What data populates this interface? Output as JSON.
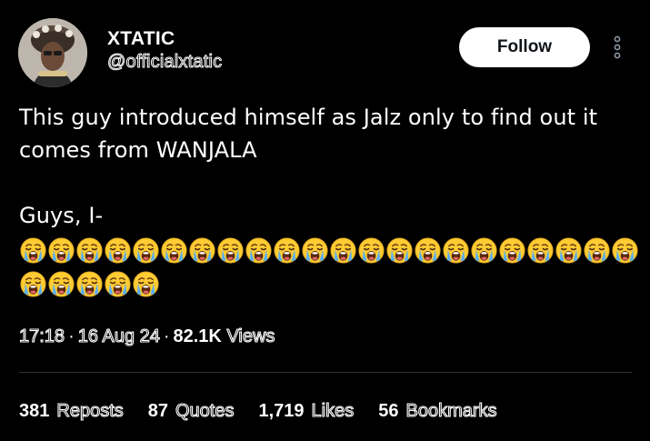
{
  "author": {
    "display_name": "XTATIC",
    "handle": "@officialxtatic"
  },
  "actions": {
    "follow_label": "Follow",
    "more_icon": "more-vertical-icon"
  },
  "tweet": {
    "lines": [
      "This guy introduced himself as Jalz only to find out it",
      "comes from WANJALA",
      "",
      "Guys, I-"
    ],
    "emoji": {
      "name": "loudly-crying-face",
      "row1_count": 22,
      "row2_count": 5
    }
  },
  "meta": {
    "time": "17:18",
    "date": "16 Aug 24",
    "separator": "·",
    "views_count": "82.1K",
    "views_label": "Views"
  },
  "stats": {
    "reposts": {
      "count": "381",
      "label": "Reposts"
    },
    "quotes": {
      "count": "87",
      "label": "Quotes"
    },
    "likes": {
      "count": "1,719",
      "label": "Likes"
    },
    "bookmarks": {
      "count": "56",
      "label": "Bookmarks"
    }
  },
  "colors": {
    "background": "#000000",
    "text": "#ffffff",
    "divider": "#2f3336",
    "button_bg": "#ffffff",
    "button_text": "#0f1419",
    "emoji_face": "#ffcc33",
    "emoji_tear": "#5ab0f0"
  }
}
